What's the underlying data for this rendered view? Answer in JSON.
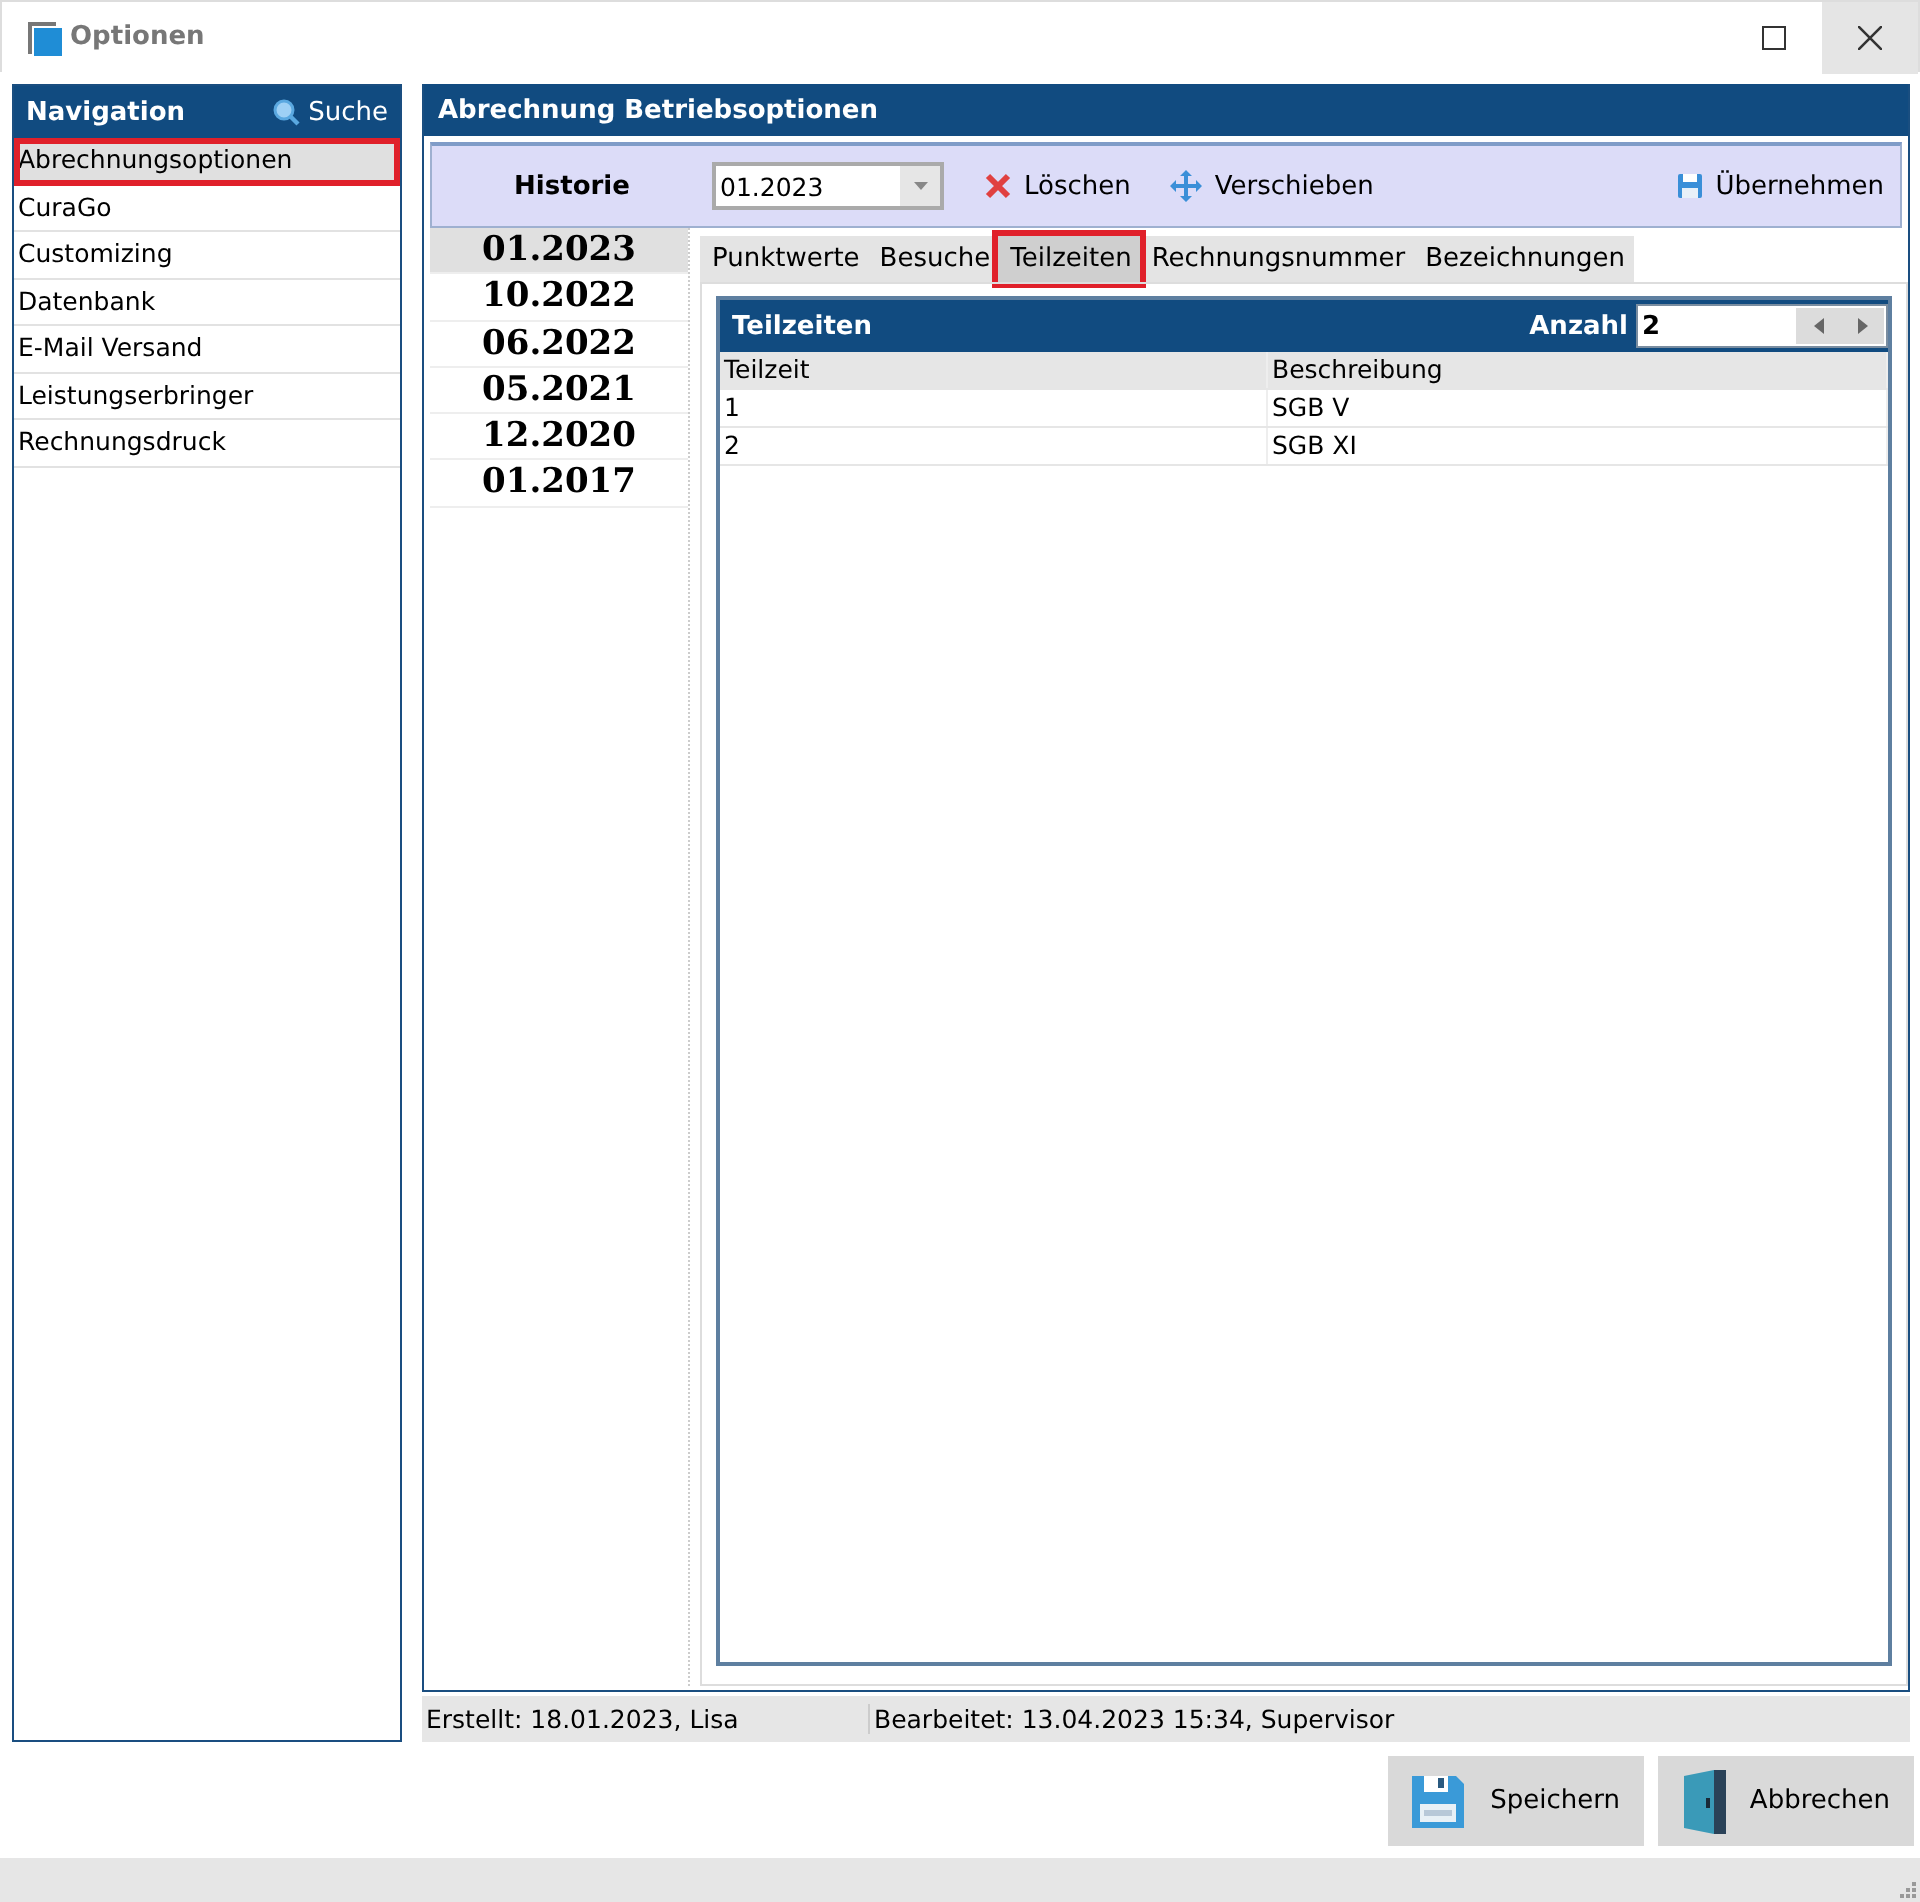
{
  "window": {
    "title": "Optionen"
  },
  "navigation": {
    "title": "Navigation",
    "search": "Suche",
    "items": [
      {
        "label": "Abrechnungsoptionen",
        "selected": true,
        "marked": true
      },
      {
        "label": "CuraGo",
        "selected": false,
        "marked": false
      },
      {
        "label": "Customizing",
        "selected": false,
        "marked": false
      },
      {
        "label": "Datenbank",
        "selected": false,
        "marked": false
      },
      {
        "label": "E-Mail Versand",
        "selected": false,
        "marked": false
      },
      {
        "label": "Leistungserbringer",
        "selected": false,
        "marked": false
      },
      {
        "label": "Rechnungsdruck",
        "selected": false,
        "marked": false
      }
    ]
  },
  "panel": {
    "title": "Abrechnung Betriebsoptionen",
    "history_label": "Historie",
    "history_value": "01.2023",
    "actions": [
      {
        "label": "Löschen",
        "kind": "delete"
      },
      {
        "label": "Verschieben",
        "kind": "move"
      },
      {
        "label": "Übernehmen",
        "kind": "apply"
      }
    ],
    "history": [
      {
        "label": "01.2023",
        "selected": true
      },
      {
        "label": "10.2022",
        "selected": false
      },
      {
        "label": "06.2022",
        "selected": false
      },
      {
        "label": "05.2021",
        "selected": false
      },
      {
        "label": "12.2020",
        "selected": false
      },
      {
        "label": "01.2017",
        "selected": false
      }
    ],
    "tabs": [
      {
        "label": "Punktwerte",
        "selected": false,
        "marked": false
      },
      {
        "label": "Besuche",
        "selected": false,
        "marked": false
      },
      {
        "label": "Teilzeiten",
        "selected": true,
        "marked": true
      },
      {
        "label": "Rechnungsnummer",
        "selected": false,
        "marked": false
      },
      {
        "label": "Bezeichnungen",
        "selected": false,
        "marked": false
      }
    ],
    "table": {
      "title": "Teilzeiten",
      "count_label": "Anzahl",
      "count": "2",
      "columns": [
        "Teilzeit",
        "Beschreibung"
      ],
      "rows": [
        [
          "1",
          "SGB V"
        ],
        [
          "2",
          "SGB XI"
        ]
      ]
    }
  },
  "status": {
    "created": "Erstellt: 18.01.2023, Lisa",
    "edited": "Bearbeitet: 13.04.2023 15:34, Supervisor"
  },
  "buttons": [
    {
      "label": "Speichern",
      "kind": "save"
    },
    {
      "label": "Abbrechen",
      "kind": "cancel"
    }
  ]
}
